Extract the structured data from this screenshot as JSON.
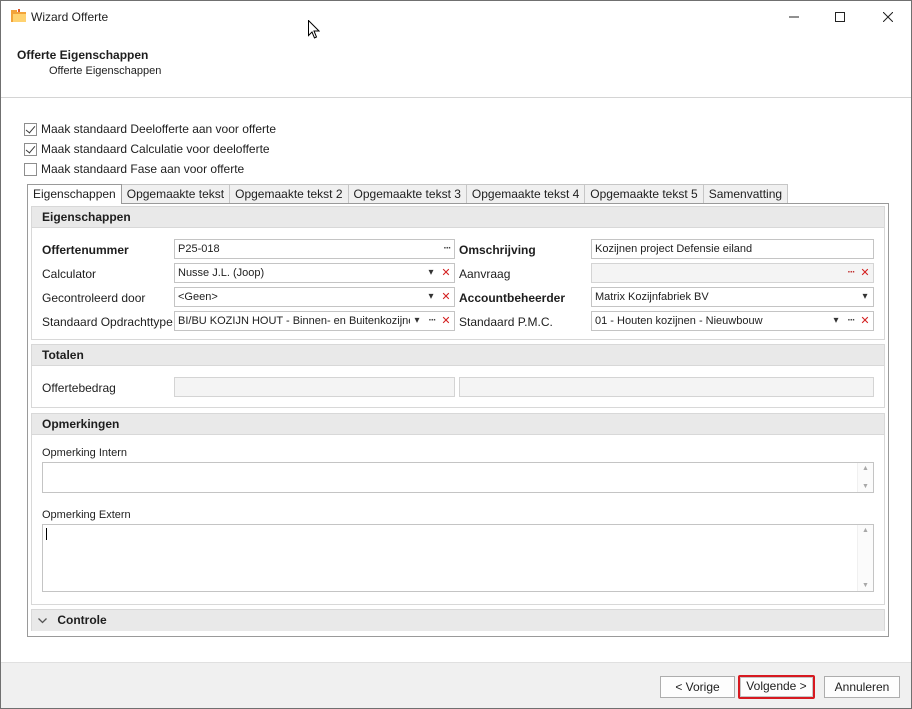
{
  "window": {
    "title": "Wizard Offerte"
  },
  "header": {
    "title": "Offerte Eigenschappen",
    "subtitle": "Offerte Eigenschappen"
  },
  "checkboxes": [
    {
      "label": "Maak standaard Deelofferte aan voor offerte",
      "checked": true
    },
    {
      "label": "Maak standaard Calculatie voor deelofferte",
      "checked": true
    },
    {
      "label": "Maak standaard Fase aan voor offerte",
      "checked": false
    }
  ],
  "tabs": [
    {
      "label": "Eigenschappen",
      "active": true
    },
    {
      "label": "Opgemaakte tekst"
    },
    {
      "label": "Opgemaakte tekst 2"
    },
    {
      "label": "Opgemaakte tekst 3"
    },
    {
      "label": "Opgemaakte tekst 4"
    },
    {
      "label": "Opgemaakte tekst 5"
    },
    {
      "label": "Samenvatting"
    }
  ],
  "eigenschappen": {
    "header": "Eigenschappen",
    "offertenummer": {
      "label": "Offertenummer",
      "value": "P25-018"
    },
    "calculator": {
      "label": "Calculator",
      "value": "Nusse J.L. (Joop)"
    },
    "gecontroleerd": {
      "label": "Gecontroleerd door",
      "value": "<Geen>"
    },
    "opdrachttype": {
      "label": "Standaard Opdrachttype",
      "value": "BI/BU KOZIJN HOUT - Binnen- en Buitenkozijner"
    },
    "omschrijving": {
      "label": "Omschrijving",
      "value": "Kozijnen project Defensie eiland"
    },
    "aanvraag": {
      "label": "Aanvraag",
      "value": ""
    },
    "accountbeheerder": {
      "label": "Accountbeheerder",
      "value": "Matrix Kozijnfabriek BV"
    },
    "pmc": {
      "label": "Standaard P.M.C.",
      "value": "01 - Houten kozijnen - Nieuwbouw"
    }
  },
  "totalen": {
    "header": "Totalen",
    "offertebedrag_label": "Offertebedrag",
    "value1": "",
    "value2": ""
  },
  "opmerkingen": {
    "header": "Opmerkingen",
    "intern_label": "Opmerking Intern",
    "intern_value": "",
    "extern_label": "Opmerking Extern",
    "extern_value": ""
  },
  "controle": {
    "header": "Controle"
  },
  "footer": {
    "prev_label": "< Vorige",
    "next_label": "Volgende >",
    "cancel_label": "Annuleren"
  },
  "colors": {
    "focus_border": "#d71920",
    "clear_x": "#d42020",
    "group_header_bg": "#e9e9e9"
  },
  "icons": [
    "wizard-folder-icon",
    "minimize-icon",
    "maximize-icon",
    "close-icon",
    "ellipsis-icon",
    "dropdown-arrow-icon",
    "clear-x-icon",
    "chevron-down-icon",
    "mouse-cursor-icon"
  ]
}
